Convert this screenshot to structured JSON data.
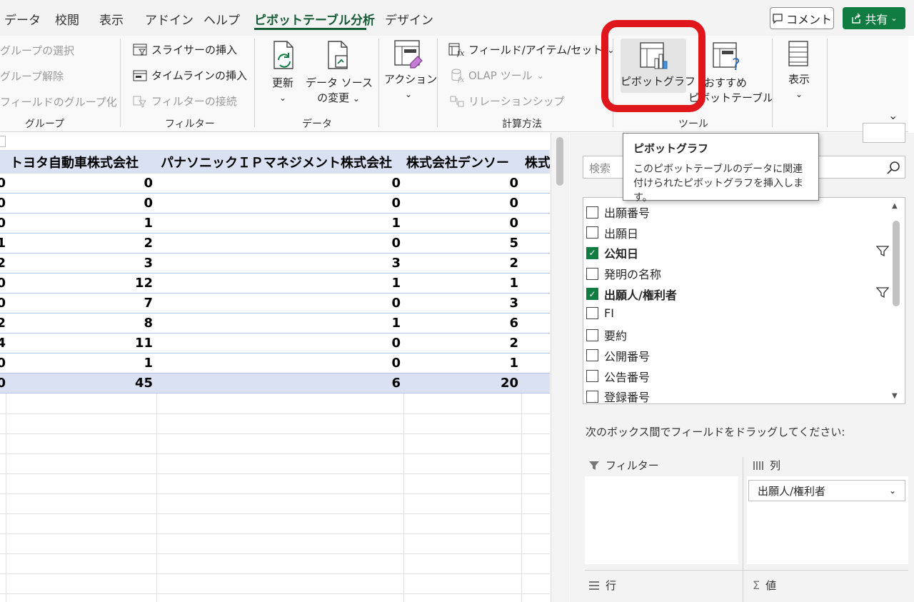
{
  "tabs": [
    "データ",
    "校閲",
    "表示",
    "アドイン",
    "ヘルプ",
    "ピボットテーブル分析",
    "デザイン"
  ],
  "active_tab": "ピボットテーブル分析",
  "buttons": {
    "comment": "コメント",
    "share": "共有"
  },
  "ribbon": {
    "group_group": {
      "label": "グループ",
      "items": [
        "グループの選択",
        "グループ解除",
        "フィールドのグループ化"
      ]
    },
    "filter_group": {
      "label": "フィルター",
      "items": [
        "スライサーの挿入",
        "タイムラインの挿入",
        "フィルターの接続"
      ]
    },
    "data_group": {
      "label": "データ",
      "refresh": "更新",
      "change_source_1": "データ ソース",
      "change_source_2": "の変更"
    },
    "action": "アクション",
    "calc_group": {
      "label": "計算方法",
      "items": [
        "フィールド/アイテム/セット",
        "OLAP ツール",
        "リレーションシップ"
      ]
    },
    "tools_group": {
      "label": "ツール",
      "pivot_chart": "ピボットグラフ",
      "recommended_1": "おすすめ",
      "recommended_2": "ピボットテーブル"
    },
    "show": "表示"
  },
  "sheet": {
    "headers": [
      "トヨタ自動車株式会社",
      "パナソニックＩＰマネジメント株式会社",
      "株式会社デンソー",
      "株式"
    ],
    "rows": [
      {
        "a": "0",
        "b": "0",
        "c": "0",
        "d": "0"
      },
      {
        "a": "0",
        "b": "0",
        "c": "0",
        "d": "0"
      },
      {
        "a": "0",
        "b": "1",
        "c": "1",
        "d": "0"
      },
      {
        "a": "1",
        "b": "2",
        "c": "0",
        "d": "5"
      },
      {
        "a": "2",
        "b": "3",
        "c": "3",
        "d": "2"
      },
      {
        "a": "0",
        "b": "12",
        "c": "1",
        "d": "1"
      },
      {
        "a": "0",
        "b": "7",
        "c": "0",
        "d": "3"
      },
      {
        "a": "2",
        "b": "8",
        "c": "1",
        "d": "6"
      },
      {
        "a": "4",
        "b": "11",
        "c": "0",
        "d": "2"
      },
      {
        "a": "0",
        "b": "1",
        "c": "0",
        "d": "1"
      }
    ],
    "total": {
      "a": "0",
      "b": "45",
      "c": "6",
      "d": "20"
    }
  },
  "tooltip": {
    "title": "ピボットグラフ",
    "body": "このピボットテーブルのデータに関連付けられたピボットグラフを挿入します。"
  },
  "pane": {
    "search_placeholder": "検索",
    "fields": [
      {
        "label": "出願番号",
        "checked": false
      },
      {
        "label": "出願日",
        "checked": false
      },
      {
        "label": "公知日",
        "checked": true
      },
      {
        "label": "発明の名称",
        "checked": false
      },
      {
        "label": "出願人/権利者",
        "checked": true
      },
      {
        "label": "FI",
        "checked": false
      },
      {
        "label": "要約",
        "checked": false
      },
      {
        "label": "公開番号",
        "checked": false
      },
      {
        "label": "公告番号",
        "checked": false
      },
      {
        "label": "登録番号",
        "checked": false
      }
    ],
    "instructions": "次のボックス間でフィールドをドラッグしてください:",
    "areas": {
      "filter": "フィルター",
      "columns": "列",
      "rows": "行",
      "values": "値"
    },
    "column_field": "出願人/権利者"
  },
  "colors": {
    "accent": "#185c37",
    "excel_green": "#107c41",
    "highlight": "#e0161d",
    "header_fill": "#d9e1f2"
  }
}
